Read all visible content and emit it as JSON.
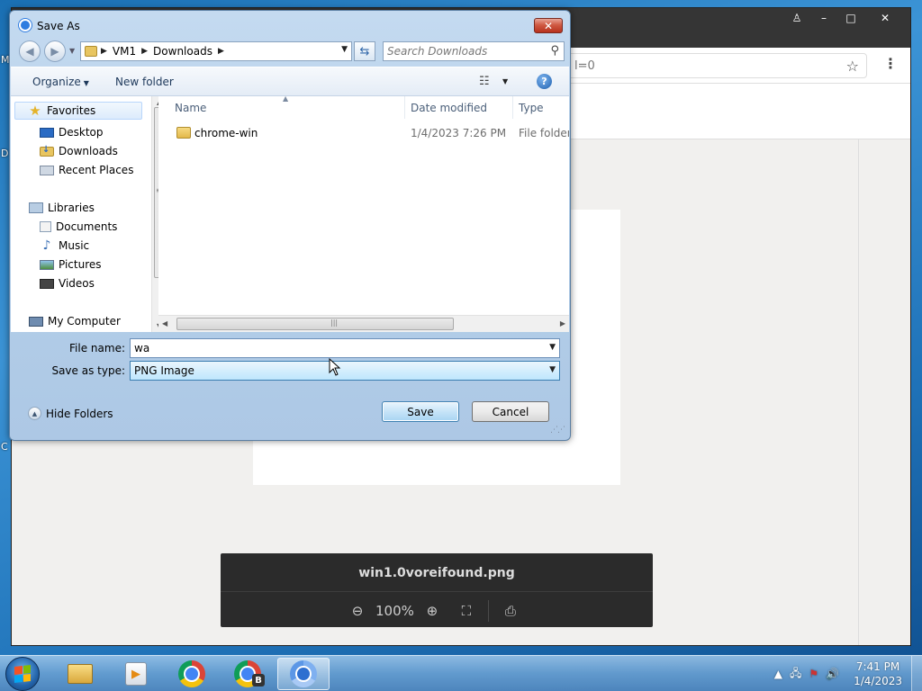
{
  "desktop": {
    "edge_letters": [
      "M",
      "D",
      "C"
    ]
  },
  "browser": {
    "address_fragment": "l=0",
    "window_controls": {
      "user": "♙",
      "minimize": "–",
      "maximize": "□",
      "close": "✕"
    },
    "viewer": {
      "filename": "win1.0voreifound.png",
      "zoom": "100%"
    }
  },
  "dialog": {
    "title": "Save As",
    "close_label": "✕",
    "breadcrumb": [
      "VM1",
      "Downloads"
    ],
    "search_placeholder": "Search Downloads",
    "toolbar": {
      "organize": "Organize",
      "new_folder": "New folder",
      "help": "?"
    },
    "nav": {
      "favorites": "Favorites",
      "desktop": "Desktop",
      "downloads": "Downloads",
      "recent_places": "Recent Places",
      "libraries": "Libraries",
      "documents": "Documents",
      "music": "Music",
      "pictures": "Pictures",
      "videos": "Videos",
      "my_computer": "My Computer"
    },
    "columns": {
      "name": "Name",
      "date_modified": "Date modified",
      "type": "Type"
    },
    "files": [
      {
        "name": "chrome-win",
        "date": "1/4/2023 7:26 PM",
        "type": "File folder"
      }
    ],
    "file_name_label": "File name:",
    "file_name_value": "wa",
    "save_type_label": "Save as type:",
    "save_type_value": "PNG Image",
    "hide_folders": "Hide Folders",
    "save_button": "Save",
    "cancel_button": "Cancel"
  },
  "taskbar": {
    "clock_time": "7:41 PM",
    "clock_date": "1/4/2023",
    "chrome_badge": "B"
  }
}
